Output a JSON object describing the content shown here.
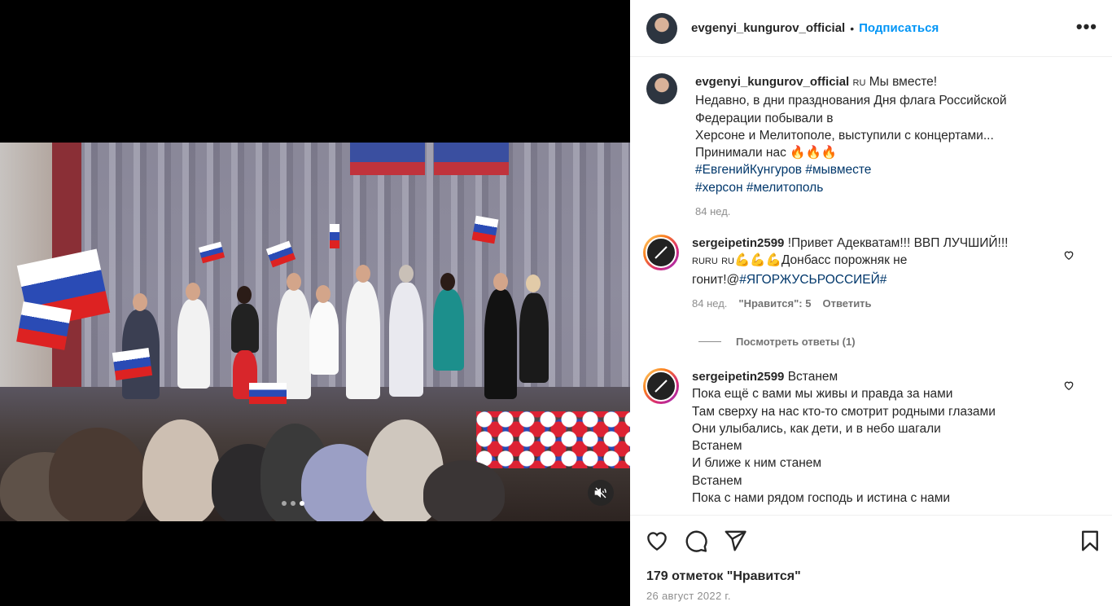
{
  "post": {
    "author": "evgenyi_kungurov_official",
    "bullet": "•",
    "follow_label": "Подписаться",
    "more_label": "•••"
  },
  "caption": {
    "author": "evgenyi_kungurov_official",
    "flag": "RU",
    "lines": [
      "Мы вместе!",
      "Недавно, в дни празднования Дня флага Российской Федерации побывали в",
      "Херсоне и Мелитополе, выступили с концертами...",
      "Принимали нас 🔥🔥🔥"
    ],
    "hashtags_line1": "#ЕвгенийКунгуров #мывместе",
    "hashtags_line2": "#херсон #мелитополь",
    "time": "84 нед."
  },
  "comments": [
    {
      "author": "sergeipetin2599",
      "text_a": "!Привет Адекватам!!! ВВП ЛУЧШИЙ!!!",
      "flags_a": "RURU",
      "flags_b": "RU",
      "emoji": "💪💪💪",
      "text_b": "Донбасс порожняк не гонит!@",
      "hashtag": "#ЯГОРЖУСЬРОССИЕЙ#",
      "time": "84 нед.",
      "likes": "\"Нравится\": 5",
      "reply": "Ответить"
    },
    {
      "author": "sergeipetin2599",
      "lines": [
        "Встанем",
        "Пока ещё с вами мы живы и правда за нами",
        "Там сверху на нас кто-то смотрит родными глазами",
        "Они улыбались, как дети, и в небо шагали",
        "Встанем",
        "И ближе к ним станем",
        "Встанем",
        "Пока с нами рядом господь и истина с нами"
      ]
    }
  ],
  "view_replies": "Посмотреть ответы (1)",
  "footer": {
    "likes": "179 отметок \"Нравится\"",
    "date": "26 август 2022 г."
  },
  "icons": {
    "like": "heart-icon",
    "comment": "comment-icon",
    "share": "share-icon",
    "save": "bookmark-icon",
    "mute": "mute-icon"
  },
  "carousel": {
    "count": 3,
    "active_index": 2
  },
  "colors": {
    "link": "#0095f6",
    "hashtag": "#00376b",
    "muted": "#8e8e8e"
  }
}
